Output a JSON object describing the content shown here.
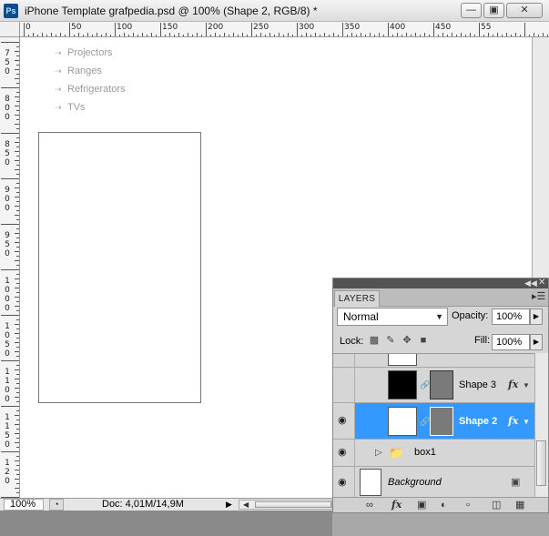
{
  "window": {
    "app_icon": "Ps",
    "title": "iPhone Template grafpedia.psd @ 100% (Shape 2, RGB/8) *",
    "min_icon": "minimize-icon",
    "max_icon": "maximize-icon",
    "close_icon": "close-icon"
  },
  "ruler": {
    "top_labels": [
      "0",
      "50",
      "100",
      "150",
      "200",
      "250",
      "300",
      "350",
      "400",
      "450",
      "55"
    ],
    "left_labels": [
      "750",
      "800",
      "850",
      "900",
      "950",
      "1000",
      "1050",
      "1100",
      "1150",
      "120"
    ]
  },
  "canvas": {
    "nav_items": [
      "Projectors",
      "Ranges",
      "Refrigerators",
      "TVs"
    ]
  },
  "statusbar": {
    "zoom": "100%",
    "doc": "Doc: 4,01M/14,9M"
  },
  "layers_panel": {
    "tab": "LAYERS",
    "blend_mode": "Normal",
    "opacity_label": "Opacity:",
    "opacity_value": "100%",
    "lock_label": "Lock:",
    "fill_label": "Fill:",
    "fill_value": "100%",
    "layers": [
      {
        "name": "Shape 3",
        "visible": false,
        "selected": false,
        "thumb": "black",
        "fx": true
      },
      {
        "name": "Shape 2",
        "visible": true,
        "selected": true,
        "thumb": "white",
        "fx": true
      },
      {
        "name": "box1",
        "visible": true,
        "selected": false,
        "type": "group"
      },
      {
        "name": "Background",
        "visible": true,
        "selected": false,
        "locked": true
      }
    ],
    "fx_label": "fx",
    "colors": {
      "selected_row": "#3399ff",
      "panel_bg": "#d6d6d6"
    }
  }
}
